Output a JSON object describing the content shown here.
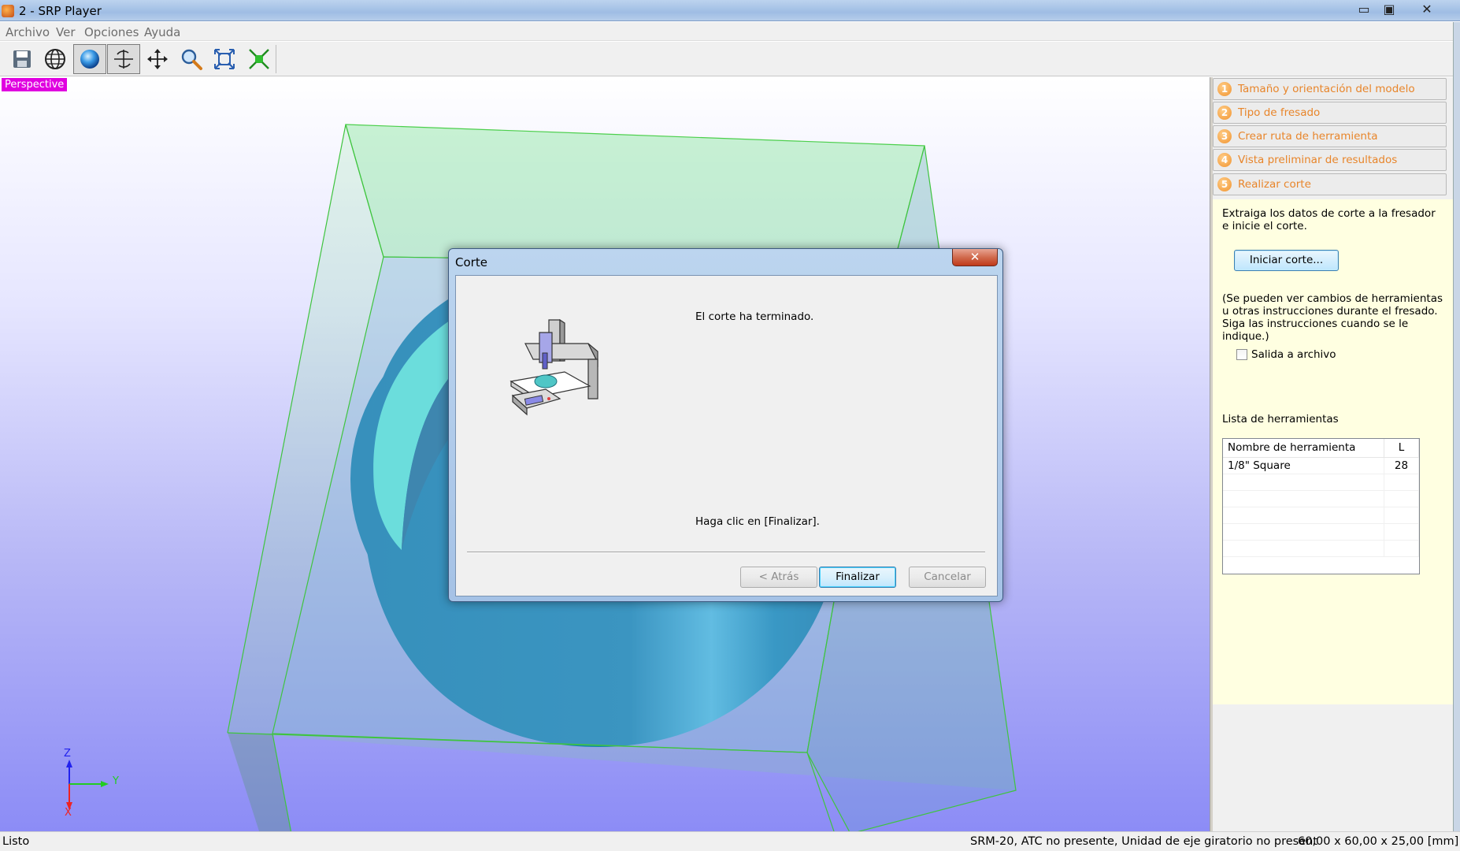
{
  "window": {
    "title": "2 - SRP Player",
    "minimize": "▭",
    "restore": "▣",
    "close": "✕"
  },
  "menu": [
    "Archivo",
    "Ver",
    "Opciones",
    "Ayuda"
  ],
  "viewport": {
    "label": "Perspective",
    "axes": {
      "z": "Z",
      "y": "Y",
      "x": "X"
    }
  },
  "steps": [
    {
      "num": "1",
      "label": "Tamaño y orientación del modelo"
    },
    {
      "num": "2",
      "label": "Tipo de fresado"
    },
    {
      "num": "3",
      "label": "Crear ruta de herramienta"
    },
    {
      "num": "4",
      "label": "Vista preliminar de resultados"
    },
    {
      "num": "5",
      "label": "Realizar corte"
    }
  ],
  "cut_panel": {
    "description": "Extraiga los datos de corte a la fresador e inicie el corte.",
    "start_button": "Iniciar corte...",
    "note": "(Se pueden ver cambios de herramientas u otras instrucciones durante el fresado. Siga las instrucciones cuando se le indique.)",
    "output_to_file": "Salida a archivo",
    "tool_list_label": "Lista de herramientas",
    "tool_table": {
      "headers": [
        "Nombre de herramienta",
        "L"
      ],
      "rows": [
        [
          "1/8\" Square",
          "28"
        ]
      ]
    }
  },
  "dialog": {
    "title": "Corte",
    "close": "✕",
    "message": "El corte ha terminado.",
    "instruction": "Haga clic en [Finalizar].",
    "back": "< Atrás",
    "finish": "Finalizar",
    "cancel": "Cancelar"
  },
  "status": {
    "left": "Listo",
    "machine": "SRM-20, ATC no presente, Unidad de eje giratorio no present",
    "dims": "60,00 x  60,00 x  25,00 [mm]"
  }
}
